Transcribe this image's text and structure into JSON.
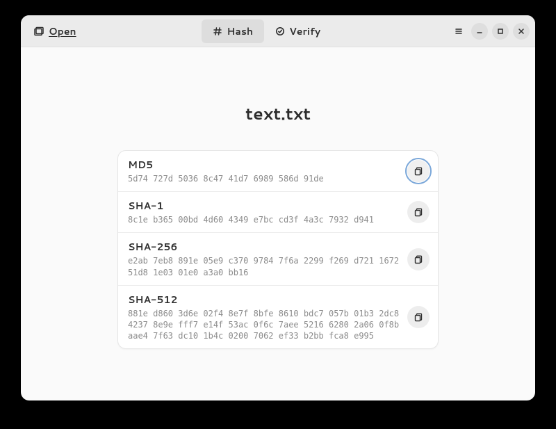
{
  "header": {
    "open_label": "Open",
    "hash_tab": "Hash",
    "verify_tab": "Verify"
  },
  "filename": "text.txt",
  "hashes": [
    {
      "name": "MD5",
      "value": "5d74 727d 5036 8c47 41d7 6989 586d 91de"
    },
    {
      "name": "SHA-1",
      "value": "8c1e b365 00bd 4d60 4349 e7bc cd3f 4a3c 7932 d941"
    },
    {
      "name": "SHA-256",
      "value": "e2ab 7eb8 891e 05e9 c370 9784 7f6a 2299 f269 d721 1672 51d8 1e03 01e0 a3a0 bb16"
    },
    {
      "name": "SHA-512",
      "value": "881e d860 3d6e 02f4 8e7f 8bfe 8610 bdc7 057b 01b3 2dc8 4237 8e9e fff7 e14f 53ac 0f6c 7aee 5216 6280 2a06 0f8b aae4 7f63 dc10 1b4c 0200 7062 ef33 b2bb fca8 e995"
    }
  ]
}
